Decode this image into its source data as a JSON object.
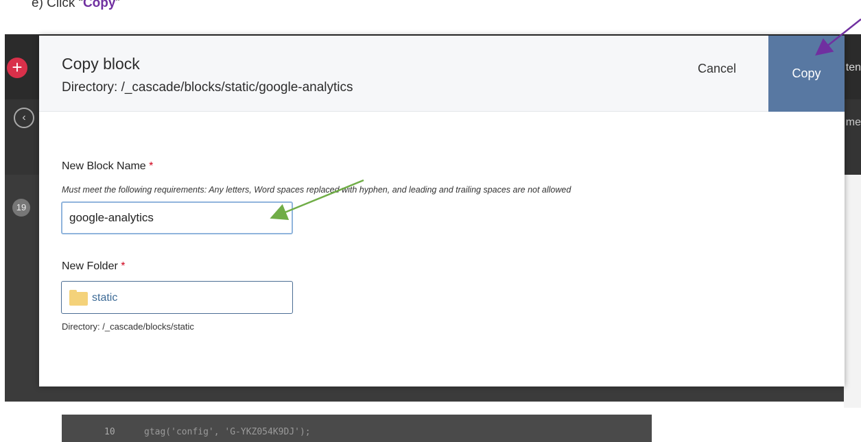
{
  "caption": {
    "prefix": "e)  Click “",
    "highlight": "Copy",
    "suffix": "”"
  },
  "background_app": {
    "badge_count": "19",
    "right_text_top": "ten",
    "right_text_mid": "me",
    "editor": {
      "line_number": "10",
      "code": "gtag('config', 'G-YKZ054K9DJ');"
    }
  },
  "modal": {
    "title": "Copy block",
    "directory": "Directory: /_cascade/blocks/static/google-analytics",
    "cancel_label": "Cancel",
    "copy_label": "Copy",
    "name_field": {
      "label": "New Block Name",
      "required_mark": "*",
      "help": "Must meet the following requirements: Any letters, Word spaces replaced with hyphen, and leading and trailing spaces are not allowed",
      "value": "google-analytics"
    },
    "folder_field": {
      "label": "New Folder",
      "required_mark": "*",
      "value": "static",
      "directory": "Directory: /_cascade/blocks/static"
    }
  },
  "colors": {
    "copy_button": "#5878a2",
    "required": "#d0021b",
    "arrow_green": "#70ad47",
    "arrow_purple": "#7030a0",
    "folder_icon": "#f4d27a"
  },
  "icons": [
    "plus-icon",
    "back-circle-icon",
    "folder-icon",
    "arrow-annotation"
  ]
}
